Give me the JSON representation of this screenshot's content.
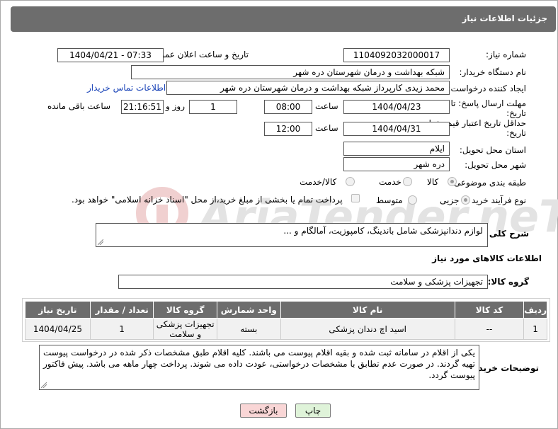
{
  "page": {
    "title": "جزئیات اطلاعات نیاز"
  },
  "fields": {
    "need_number_label": "شماره نیاز:",
    "need_number": "1104092032000017",
    "announce_label": "تاریخ و ساعت اعلان عمومی:",
    "announce_value": "1404/04/21 - 07:33",
    "buyer_org_label": "نام دستگاه خریدار:",
    "buyer_org": "شبکه بهداشت و درمان شهرستان دره شهر",
    "creator_label": "ایجاد کننده درخواست:",
    "creator": "محمد زیدی کارپرداز شبکه بهداشت و درمان شهرستان دره شهر",
    "contact_link": "اطلاعات تماس خریدار",
    "deadline_label": "مهلت ارسال پاسخ: تا تاریخ:",
    "deadline_date": "1404/04/23",
    "time_label": "ساعت",
    "deadline_time": "08:00",
    "days_value": "1",
    "days_label": "روز و",
    "remaining_time": "21:16:51",
    "remaining_label": "ساعت باقی مانده",
    "validity_label": "حداقل تاریخ اعتبار قیمت: تا تاریخ:",
    "validity_date": "1404/04/31",
    "validity_time": "12:00",
    "province_label": "استان محل تحویل:",
    "province": "ایلام",
    "city_label": "شهر محل تحویل:",
    "city": "دره شهر",
    "category_label": "طبقه بندی موضوعی:",
    "category_options": [
      "کالا",
      "خدمت",
      "کالا/خدمت"
    ],
    "category_selected": "کالا",
    "process_label": "نوع فرآیند خرید :",
    "process_options": [
      "جزیی",
      "متوسط"
    ],
    "process_selected": "جزیی",
    "payment_note": "پرداخت تمام یا بخشی از مبلغ خرید،از محل \"اسناد خزانه اسلامی\" خواهد بود."
  },
  "summary": {
    "label": "شرح کلی نیاز:",
    "text": "لوازم دندانپزشکی شامل باندینگ، کامپوزیت، آمالگام و ..."
  },
  "goods_section": {
    "title": "اطلاعات کالاهای مورد نیاز",
    "group_label": "گروه کالا:",
    "group_value": "تجهیزات پزشکی و سلامت"
  },
  "table": {
    "headers": [
      "ردیف",
      "کد کالا",
      "نام کالا",
      "واحد شمارش",
      "گروه کالا",
      "تعداد / مقدار",
      "تاریخ نیاز"
    ],
    "rows": [
      [
        "1",
        "--",
        "اسید اچ دندان پزشکی",
        "بسته",
        "تجهیزات پزشکی و سلامت",
        "1",
        "1404/04/25"
      ]
    ]
  },
  "buyer_notes": {
    "label": "توضیحات خریدار:",
    "text": "یکی از اقلام در سامانه ثبت شده و بقیه اقلام پیوست می باشند. کلیه اقلام طبق مشخصات ذکر شده در درخواست پیوست تهیه گردند. در صورت عدم تطابق با مشخصات درخواستی، عودت داده می شوند. پرداخت چهار ماهه می باشد. پیش فاکتور پیوست گردد."
  },
  "buttons": {
    "print": "چاپ",
    "back": "بازگشت"
  },
  "watermark": {
    "text": "AriaTender.neT"
  },
  "colors": {
    "header_bg": "#6d6d6d",
    "link": "#1a44b8",
    "back_btn_bg": "#f9d6d6",
    "print_btn_bg": "#dff3d9",
    "watermark": "#e3e3e3",
    "watermark_red": "#f0d0d0"
  }
}
